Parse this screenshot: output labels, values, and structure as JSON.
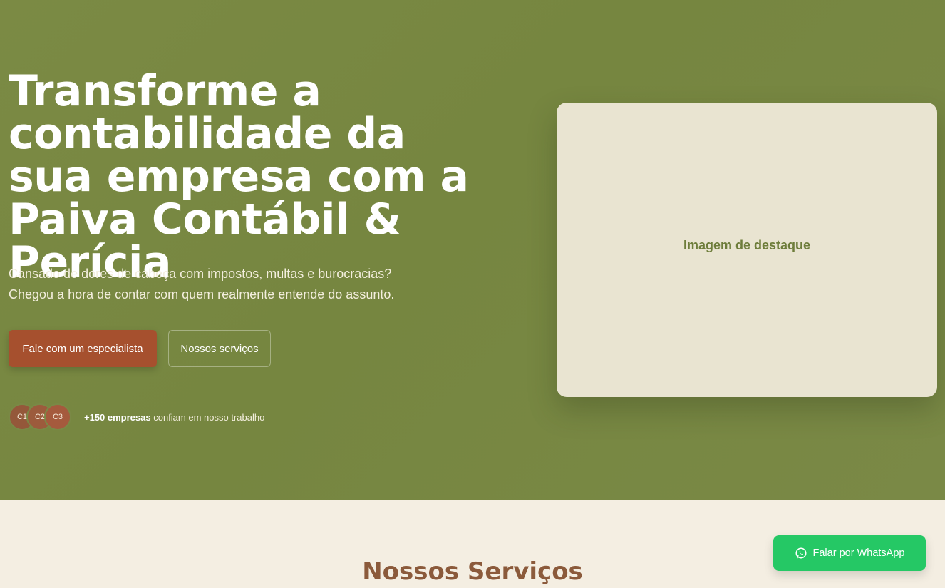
{
  "hero": {
    "title": "Transforme a contabilidade da sua empresa com a Paiva Contábil & Perícia",
    "subtitle": "Cansado de dores de cabeça com impostos, multas e burocracias? Chegou a hora de contar com quem realmente entende do assunto.",
    "primary_button": "Fale com um especialista",
    "secondary_button": "Nossos serviços",
    "avatars": [
      "C1",
      "C2",
      "C3"
    ],
    "trust_strong": "+150 empresas",
    "trust_rest": " confiam em nosso trabalho",
    "feature_image_label": "Imagem de destaque"
  },
  "services": {
    "title": "Nossos Serviços"
  },
  "whatsapp": {
    "label": "Falar por WhatsApp",
    "icon": "whatsapp-icon"
  },
  "colors": {
    "hero_bg": "#788843",
    "primary_button": "#a6502e",
    "whatsapp": "#25c865",
    "section_bg": "#f4eee2",
    "section_title": "#8b5a3b"
  }
}
